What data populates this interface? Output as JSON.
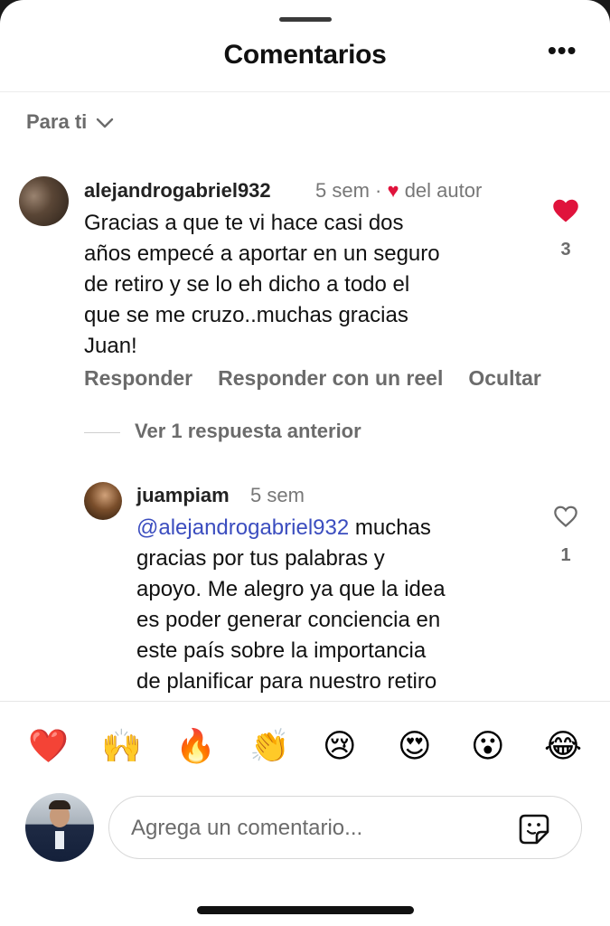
{
  "header": {
    "title": "Comentarios",
    "more_label": "•••",
    "filter_label": "Para ti",
    "filter_icon": "chevron-down-icon"
  },
  "comments": [
    {
      "username": "alejandrogabriel932",
      "time": "5 sem",
      "separator": "·",
      "author_like_icon": "heart-icon",
      "author_like_text": "del autor",
      "lines": [
        "Gracias a que te vi hace casi dos",
        "años empecé a aportar en un seguro",
        "de retiro y se lo eh dicho a todo el",
        "que se me cruzo..muchas gracias",
        "Juan!"
      ],
      "liked": true,
      "like_count": "3",
      "actions": [
        "Responder",
        "Responder con un reel",
        "Ocultar"
      ],
      "replies_toggle": "Ver 1 respuesta anterior"
    }
  ],
  "reply": {
    "username": "juampiam",
    "time": "5 sem",
    "mention": "@alejandrogabriel932",
    "first_line_rest": " muchas",
    "lines": [
      "gracias por tus palabras y",
      "apoyo. Me alegro ya que la idea",
      "es poder generar conciencia en",
      "este país sobre la importancia",
      "de planificar para nuestro retiro"
    ],
    "liked": false,
    "like_count": "1"
  },
  "reactions": [
    {
      "name": "red-heart",
      "glyph": "❤️"
    },
    {
      "name": "raising-hands",
      "glyph": "🙌"
    },
    {
      "name": "fire",
      "glyph": "🔥"
    },
    {
      "name": "clapping-hands",
      "glyph": "👏"
    },
    {
      "name": "crying-face",
      "glyph": "😢"
    },
    {
      "name": "heart-eyes",
      "glyph": "😍"
    },
    {
      "name": "surprised-face",
      "glyph": "😮"
    },
    {
      "name": "laughing-face",
      "glyph": "😂"
    }
  ],
  "composer": {
    "placeholder": "Agrega un comentario...",
    "sticker_icon": "sticker-icon"
  },
  "colors": {
    "heart": "#e0133c",
    "mention": "#3b4dbf",
    "secondary_text": "#6b6b6b"
  }
}
